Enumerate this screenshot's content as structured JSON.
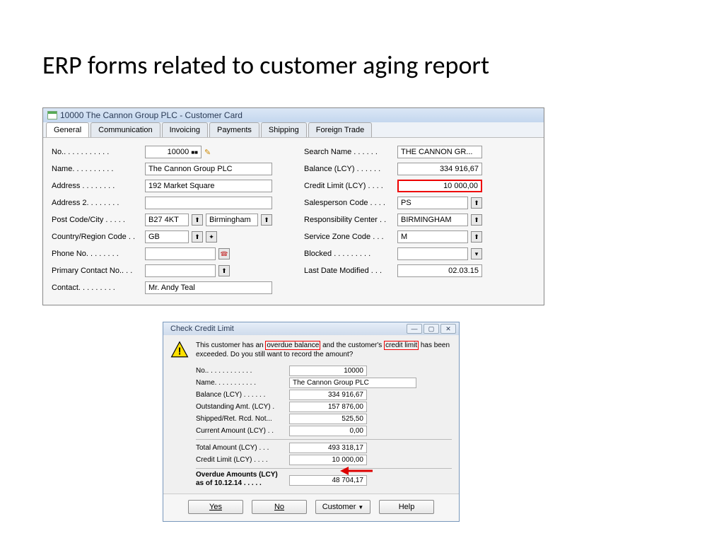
{
  "slide": {
    "title": "ERP forms related to customer aging report"
  },
  "card": {
    "windowTitle": "10000 The Cannon Group PLC - Customer Card",
    "tabs": [
      "General",
      "Communication",
      "Invoicing",
      "Payments",
      "Shipping",
      "Foreign Trade"
    ],
    "activeTab": 0,
    "left": {
      "no_label": "No.. . . . . . . . . . .",
      "no": "10000",
      "name_label": "Name. . . . . . . . . .",
      "name": "The Cannon Group PLC",
      "address_label": "Address . . . . . . . .",
      "address": "192 Market Square",
      "address2_label": "Address 2. . . . . . . .",
      "address2": "",
      "postcode_label": "Post Code/City . . . . .",
      "postcode": "B27 4KT",
      "city": "Birmingham",
      "country_label": "Country/Region Code . .",
      "country": "GB",
      "phone_label": "Phone No. . . . . . . .",
      "phone": "",
      "primary_label": "Primary Contact No.. . .",
      "primary": "",
      "contact_label": "Contact. . . . . . . . .",
      "contact": "Mr. Andy Teal"
    },
    "right": {
      "search_label": "Search Name . . . . . .",
      "search": "THE CANNON GR...",
      "balance_label": "Balance (LCY) . . . . . .",
      "balance": "334 916,67",
      "credit_label": "Credit Limit (LCY) . . . .",
      "credit": "10 000,00",
      "sales_label": "Salesperson Code . . . .",
      "sales": "PS",
      "resp_label": "Responsibility Center . .",
      "resp": "BIRMINGHAM",
      "zone_label": "Service Zone Code  . . .",
      "zone": "M",
      "blocked_label": "Blocked . . . . . . . . .",
      "blocked": "",
      "modified_label": "Last Date Modified  . . .",
      "modified": "02.03.15"
    }
  },
  "dialog": {
    "title": "Check Credit Limit",
    "msg_pre": "This customer has an ",
    "msg_ov": "overdue balance",
    "msg_mid": " and the customer's ",
    "msg_cl": "credit limit",
    "msg_post": " has been exceeded. Do you still want to record the amount?",
    "fields": {
      "no_label": "No.. . . . . . . . . . . .",
      "no": "10000",
      "name_label": "Name. . . . . . . . . . .",
      "name": "The Cannon Group PLC",
      "balance_label": "Balance (LCY) . . . . . .",
      "balance": "334 916,67",
      "out_label": "Outstanding Amt. (LCY) .",
      "out": "157 876,00",
      "ship_label": "Shipped/Ret. Rcd. Not...",
      "ship": "525,50",
      "curr_label": "Current Amount (LCY) . .",
      "curr": "0,00",
      "total_label": "Total Amount (LCY) . . .",
      "total": "493 318,17",
      "credit_label": "Credit Limit (LCY) . . . .",
      "credit": "10 000,00",
      "overdue_label1": "Overdue Amounts (LCY)",
      "overdue_label2": "as of 10.12.14 . . . . .",
      "overdue": "48 704,17"
    },
    "buttons": {
      "yes": "Yes",
      "no": "No",
      "customer": "Customer",
      "help": "Help"
    }
  }
}
